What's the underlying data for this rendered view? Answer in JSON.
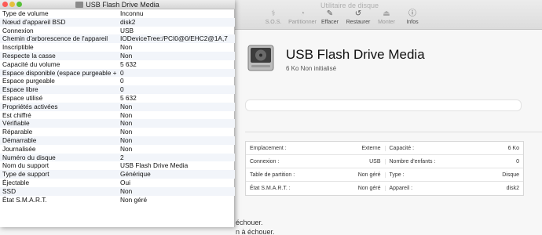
{
  "du": {
    "title": "Utilitaire de disque",
    "toolbar": [
      {
        "label": "S.O.S.",
        "icon": "stethoscope-icon",
        "glyph": "⚕",
        "active": false
      },
      {
        "label": "Partitionner",
        "icon": "partition-icon",
        "glyph": "◔",
        "active": false
      },
      {
        "label": "Effacer",
        "icon": "erase-icon",
        "glyph": "✎",
        "active": true
      },
      {
        "label": "Restaurer",
        "icon": "restore-icon",
        "glyph": "↺",
        "active": true
      },
      {
        "label": "Monter",
        "icon": "mount-icon",
        "glyph": "⏏",
        "active": false
      },
      {
        "label": "Infos",
        "icon": "info-icon",
        "glyph": "ⓘ",
        "active": true
      }
    ],
    "disk_name": "USB Flash Drive Media",
    "disk_sub": "6 Ko Non initialisé",
    "info_rows": [
      [
        {
          "k": "Emplacement :",
          "v": "Externe"
        },
        {
          "k": "Capacité :",
          "v": "6 Ko"
        }
      ],
      [
        {
          "k": "Connexion :",
          "v": "USB"
        },
        {
          "k": "Nombre d'enfants :",
          "v": "0"
        }
      ],
      [
        {
          "k": "Table de partition :",
          "v": "Non géré"
        },
        {
          "k": "Type :",
          "v": "Disque"
        }
      ],
      [
        {
          "k": "État S.M.A.R.T. :",
          "v": "Non géré"
        },
        {
          "k": "Appareil :",
          "v": "disk2"
        }
      ]
    ],
    "bg_line1": "échouer.",
    "bg_line2": "n à échouer."
  },
  "info": {
    "title": "USB Flash Drive Media",
    "rows": [
      {
        "k": "Type de volume",
        "v": "Inconnu"
      },
      {
        "k": "Nœud d'appareil BSD",
        "v": "disk2"
      },
      {
        "k": "Connexion",
        "v": "USB"
      },
      {
        "k": "Chemin d'arborescence de l'appareil",
        "v": "IODeviceTree:/PCI0@0/EHC2@1A,7"
      },
      {
        "k": "Inscriptible",
        "v": "Non"
      },
      {
        "k": "Respecte la casse",
        "v": "Non"
      },
      {
        "k": "Capacité du volume",
        "v": "5 632"
      },
      {
        "k": "Espace disponible (espace purgeable + espace libre)",
        "v": "0"
      },
      {
        "k": "Espace purgeable",
        "v": "0"
      },
      {
        "k": "Espace libre",
        "v": "0"
      },
      {
        "k": "Espace utilisé",
        "v": "5 632"
      },
      {
        "k": "Propriétés activées",
        "v": "Non"
      },
      {
        "k": "Est chiffré",
        "v": "Non"
      },
      {
        "k": "Vérifiable",
        "v": "Non"
      },
      {
        "k": "Réparable",
        "v": "Non"
      },
      {
        "k": "Démarrable",
        "v": "Non"
      },
      {
        "k": "Journalisée",
        "v": "Non"
      },
      {
        "k": "Numéro du disque",
        "v": "2"
      },
      {
        "k": "Nom du support",
        "v": "USB Flash Drive Media"
      },
      {
        "k": "Type de support",
        "v": "Générique"
      },
      {
        "k": "Éjectable",
        "v": "Oui"
      },
      {
        "k": "SSD",
        "v": "Non"
      },
      {
        "k": "État S.M.A.R.T.",
        "v": "Non géré"
      }
    ]
  },
  "colors": {
    "close": "#fc5b57",
    "minimize": "#e5bf3c",
    "zoom": "#57c038"
  }
}
